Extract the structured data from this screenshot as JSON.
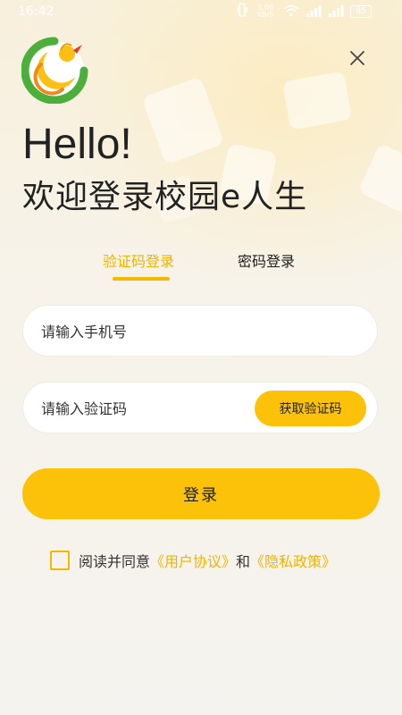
{
  "status_bar": {
    "time": "16:42",
    "speed_value": "5.00",
    "speed_unit": "KB/S",
    "battery": "85",
    "icons": [
      "vibrate-icon",
      "wifi-icon",
      "signal-icon",
      "signal-icon",
      "battery-icon"
    ]
  },
  "header": {
    "close_icon": "close-icon"
  },
  "hero": {
    "hello": "Hello!",
    "welcome": "欢迎登录校园e人生"
  },
  "tabs": [
    {
      "label": "验证码登录",
      "active": true
    },
    {
      "label": "密码登录",
      "active": false
    }
  ],
  "form": {
    "phone_placeholder": "请输入手机号",
    "code_placeholder": "请输入验证码",
    "get_code_label": "获取验证码",
    "login_label": "登录"
  },
  "agreement": {
    "prefix": "阅读并同意",
    "user_agreement": "《用户协议》",
    "conjunction": "和",
    "privacy_policy": "《隐私政策》"
  },
  "colors": {
    "accent": "#fcc20a",
    "link": "#f0b400",
    "text": "#222222"
  }
}
